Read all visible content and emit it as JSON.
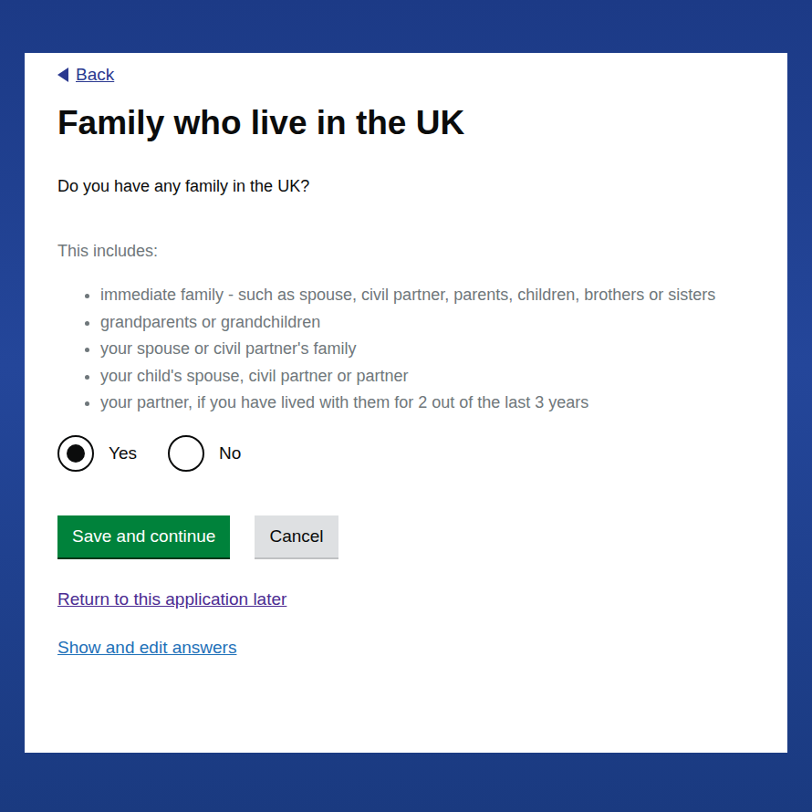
{
  "back": {
    "label": "Back"
  },
  "heading": "Family who live in the UK",
  "question": "Do you have any family in the UK?",
  "hint": {
    "intro": "This includes:",
    "items": [
      "immediate family - such as spouse, civil partner, parents, children, brothers or sisters",
      "grandparents or grandchildren",
      "your spouse or civil partner's family",
      "your child's spouse, civil partner or partner",
      "your partner, if you have lived with them for 2 out of the last 3 years"
    ]
  },
  "options": [
    {
      "label": "Yes",
      "selected": true
    },
    {
      "label": "No",
      "selected": false
    }
  ],
  "buttons": [
    {
      "label": "Save and continue",
      "kind": "primary"
    },
    {
      "label": "Cancel",
      "kind": "secondary"
    }
  ],
  "links": [
    {
      "label": "Return to this application later",
      "visited": true
    },
    {
      "label": "Show and edit answers",
      "visited": false
    }
  ]
}
